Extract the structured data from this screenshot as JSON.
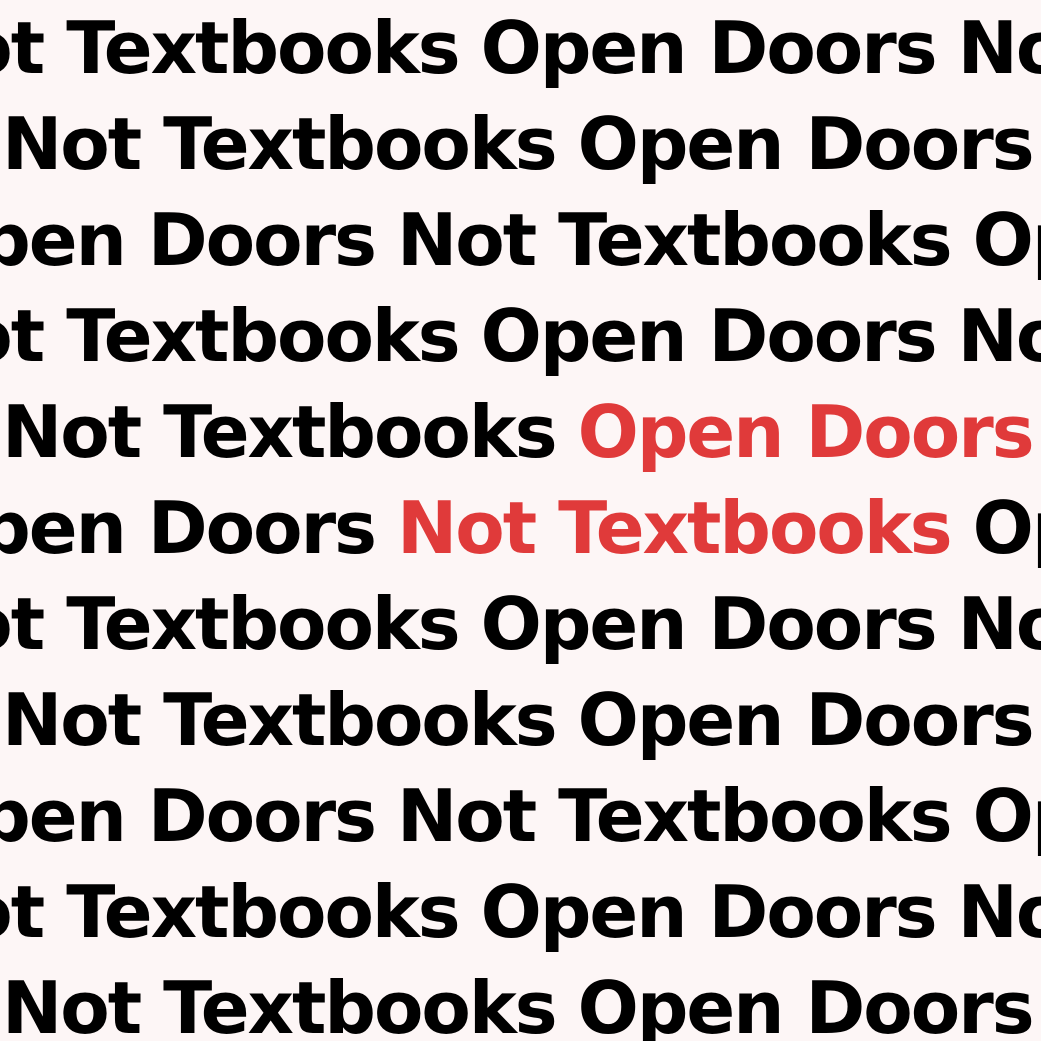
{
  "colors": {
    "background": "#fdf6f6",
    "text": "#000000",
    "highlight": "#e03a3a"
  },
  "phrases": {
    "open_doors": "Open Doors",
    "not_textbooks": "Not Textbooks"
  },
  "highlighted": [
    {
      "row": 5,
      "phrase": "Open Doors"
    },
    {
      "row": 6,
      "phrase": "Not Textbooks"
    }
  ]
}
